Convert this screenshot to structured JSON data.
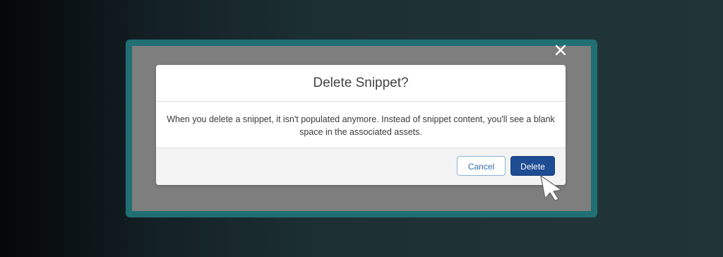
{
  "modal": {
    "title": "Delete Snippet?",
    "message": "When you delete a snippet, it isn't populated anymore. Instead of snippet content, you'll see a blank space in the associated assets.",
    "cancel_label": "Cancel",
    "delete_label": "Delete",
    "close_icon": "close-icon"
  },
  "colors": {
    "frame_accent": "#1f6f73",
    "overlay": "#7e7e7e",
    "primary_button": "#1f4d94",
    "cancel_text": "#2e6da4"
  }
}
